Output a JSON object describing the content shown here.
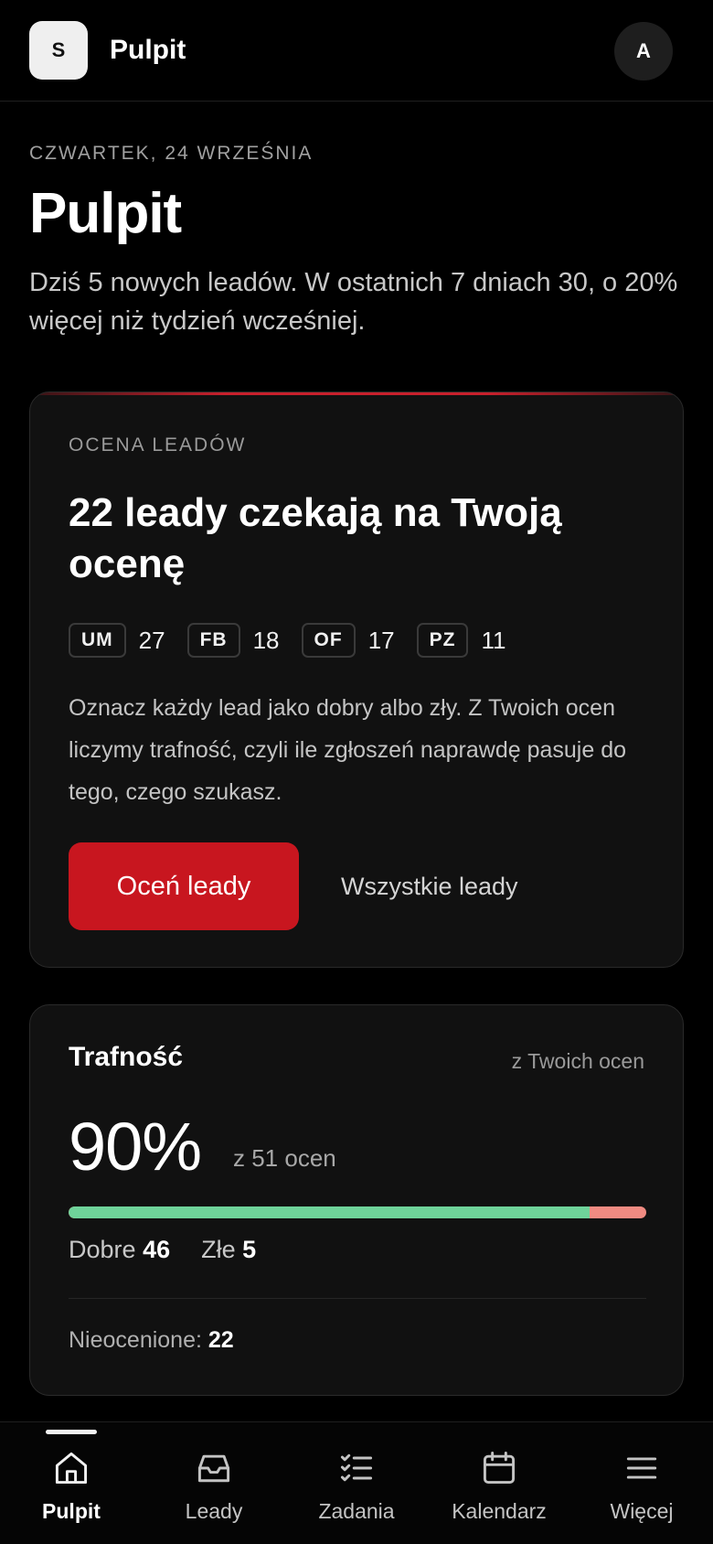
{
  "header": {
    "logo_letter": "S",
    "title": "Pulpit",
    "avatar_letter": "A"
  },
  "intro": {
    "date": "CZWARTEK, 24 WRZEŚNIA",
    "title": "Pulpit",
    "summary": "Dziś 5 nowych leadów. W ostatnich 7 dniach 30, o 20% więcej niż tydzień wcześniej."
  },
  "rating_card": {
    "section_label": "OCENA LEADÓW",
    "title": "22 leady czekają na Twoją ocenę",
    "sources": [
      {
        "tag": "UM",
        "count": "27"
      },
      {
        "tag": "FB",
        "count": "18"
      },
      {
        "tag": "OF",
        "count": "17"
      },
      {
        "tag": "PZ",
        "count": "11"
      }
    ],
    "description": "Oznacz każdy lead jako dobry albo zły. Z Twoich ocen liczymy trafność, czyli ile zgłoszeń naprawdę pasuje do tego, czego szukasz.",
    "primary_button": "Oceń leady",
    "secondary_link": "Wszystkie leady",
    "accent_color": "#c8161f"
  },
  "accuracy_card": {
    "title": "Trafność",
    "subtitle": "z Twoich ocen",
    "percent": "90%",
    "count_text": "z 51 ocen",
    "good_label": "Dobre",
    "good_value": "46",
    "bad_label": "Złe",
    "bad_value": "5",
    "good_fraction": 0.902,
    "good_color": "#6fd39a",
    "bad_color": "#f08b82",
    "unrated_label": "Nieocenione:",
    "unrated_value": "22"
  },
  "nav": {
    "items": [
      {
        "label": "Pulpit",
        "icon": "home-icon",
        "active": true
      },
      {
        "label": "Leady",
        "icon": "inbox-icon",
        "active": false
      },
      {
        "label": "Zadania",
        "icon": "checklist-icon",
        "active": false
      },
      {
        "label": "Kalendarz",
        "icon": "calendar-icon",
        "active": false
      },
      {
        "label": "Więcej",
        "icon": "menu-icon",
        "active": false
      }
    ]
  }
}
